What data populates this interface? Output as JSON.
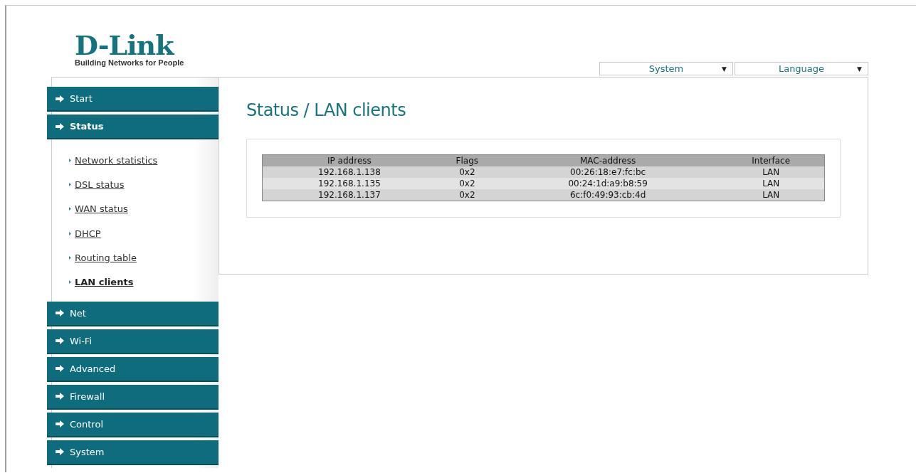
{
  "logo": {
    "name": "D-Link",
    "tagline": "Building Networks for People"
  },
  "top_menus": [
    {
      "label": "System",
      "arrow": "▼"
    },
    {
      "label": "Language",
      "arrow": "▼"
    }
  ],
  "sidebar": {
    "items": [
      {
        "label": "Start",
        "expanded": false
      },
      {
        "label": "Status",
        "expanded": true,
        "children": [
          {
            "label": "Network statistics",
            "selected": false
          },
          {
            "label": "DSL status",
            "selected": false
          },
          {
            "label": "WAN status",
            "selected": false
          },
          {
            "label": "DHCP",
            "selected": false
          },
          {
            "label": "Routing table",
            "selected": false
          },
          {
            "label": "LAN clients",
            "selected": true
          }
        ]
      },
      {
        "label": "Net",
        "expanded": false
      },
      {
        "label": "Wi-Fi",
        "expanded": false
      },
      {
        "label": "Advanced",
        "expanded": false
      },
      {
        "label": "Firewall",
        "expanded": false
      },
      {
        "label": "Control",
        "expanded": false
      },
      {
        "label": "System",
        "expanded": false
      }
    ]
  },
  "page_title": "Status / LAN clients",
  "table": {
    "columns": [
      "IP address",
      "Flags",
      "MAC-address",
      "Interface"
    ],
    "rows": [
      [
        "192.168.1.138",
        "0x2",
        "00:26:18:e7:fc:bc",
        "LAN"
      ],
      [
        "192.168.1.135",
        "0x2",
        "00:24:1d:a9:b8:59",
        "LAN"
      ],
      [
        "192.168.1.137",
        "0x2",
        "6c:f0:49:93:cb:4d",
        "LAN"
      ]
    ]
  }
}
